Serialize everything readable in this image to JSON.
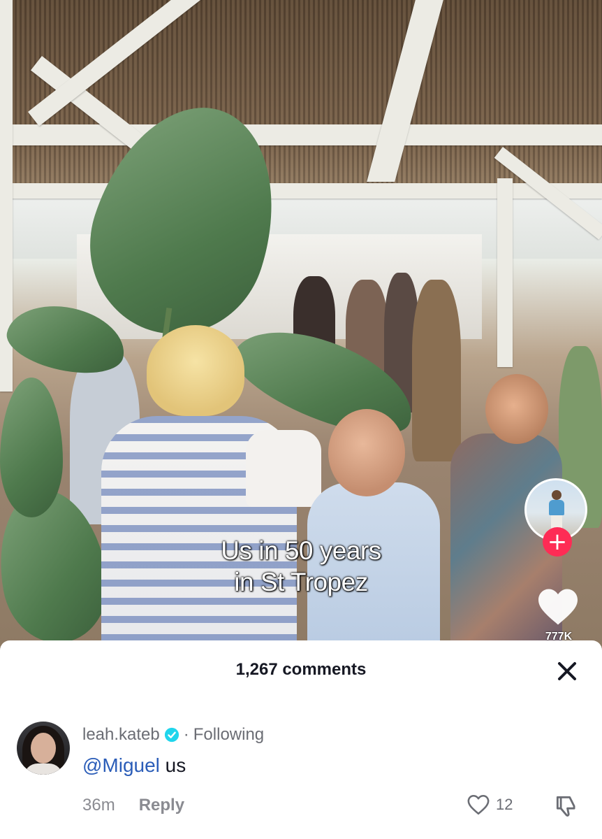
{
  "video": {
    "caption_line1": "Us in 50 years",
    "caption_line2": "in St Tropez",
    "like_count": "777K"
  },
  "comments_panel": {
    "count_label": "1,267 comments",
    "close_icon": "close-icon"
  },
  "comment": {
    "username": "leah.kateb",
    "separator": "·",
    "following_label": "Following",
    "mention": "@Miguel",
    "text": " us",
    "time": "36m",
    "reply_label": "Reply",
    "likes": "12"
  },
  "colors": {
    "follow_accent": "#fe2c55",
    "mention": "#2b5db8",
    "verified": "#20d5ec"
  }
}
